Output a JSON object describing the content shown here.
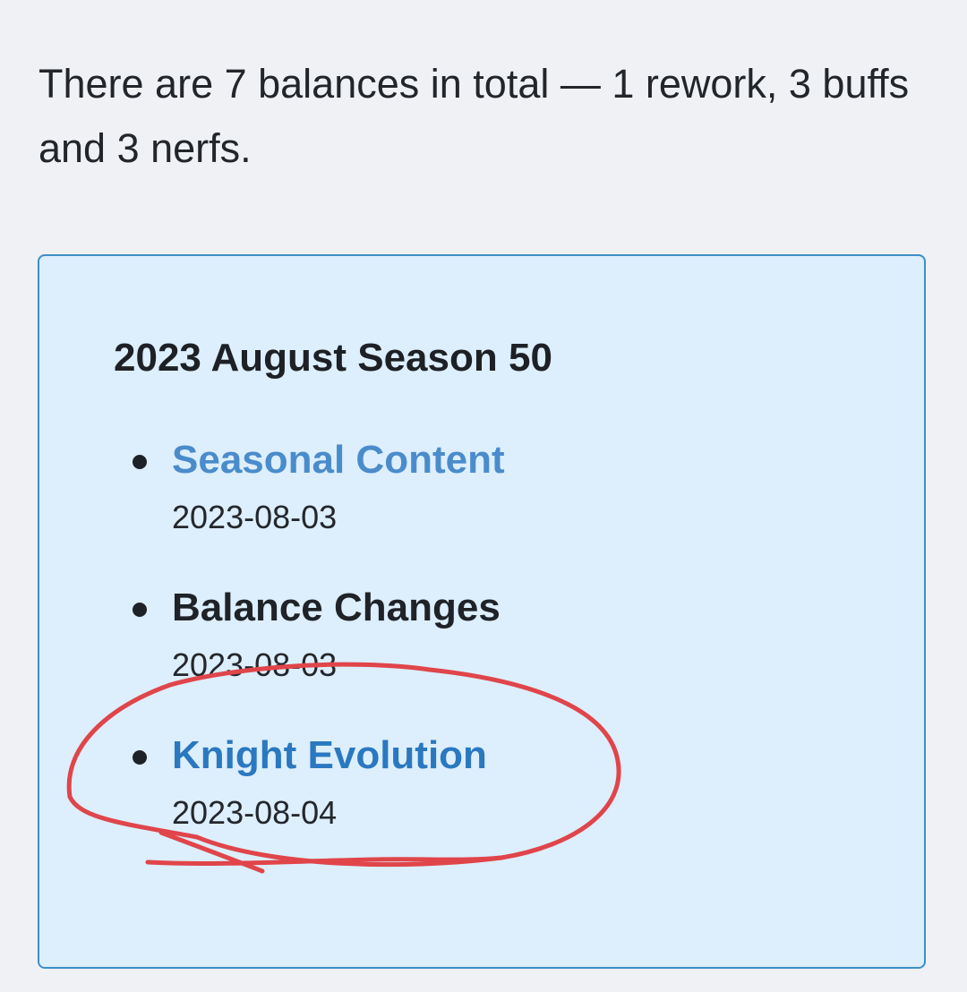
{
  "intro": {
    "text": "There are 7 balances in total — 1 rework, 3 buffs and 3 nerfs."
  },
  "season": {
    "heading": "2023 August Season 50",
    "updates": [
      {
        "title": "Seasonal Content",
        "date": "2023-08-03",
        "is_link": true
      },
      {
        "title": "Balance Changes",
        "date": "2023-08-03",
        "is_link": false
      },
      {
        "title": "Knight Evolution",
        "date": "2023-08-04",
        "is_link": true
      }
    ]
  },
  "colors": {
    "page_background": "#eff1f5",
    "panel_background": "#ddeefc",
    "panel_border": "#3d8fc6",
    "link": "#2a78c0",
    "annotation_ink": "#e0454a"
  }
}
